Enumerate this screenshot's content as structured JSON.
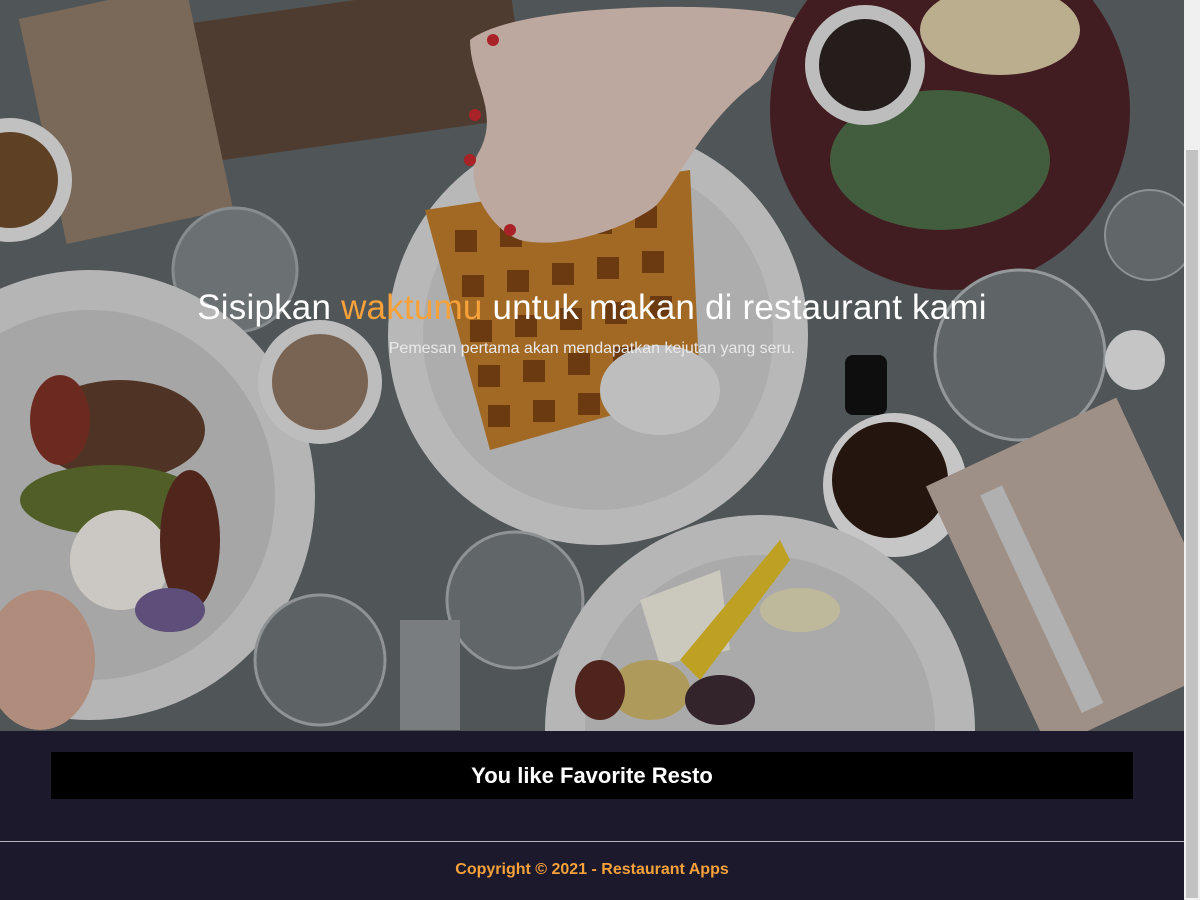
{
  "hero": {
    "title_before": "Sisipkan ",
    "title_accent": "waktumu",
    "title_after": " untuk makan di restaurant kami",
    "subtitle": "Pemesan pertama akan mendapatkan kejutan yang seru."
  },
  "main": {
    "favorite_heading": "You like Favorite Resto"
  },
  "footer": {
    "copyright": "Copyright © 2021 - Restaurant Apps"
  },
  "colors": {
    "accent": "#f6a13a",
    "background": "#1b192b",
    "banner": "#000000"
  }
}
